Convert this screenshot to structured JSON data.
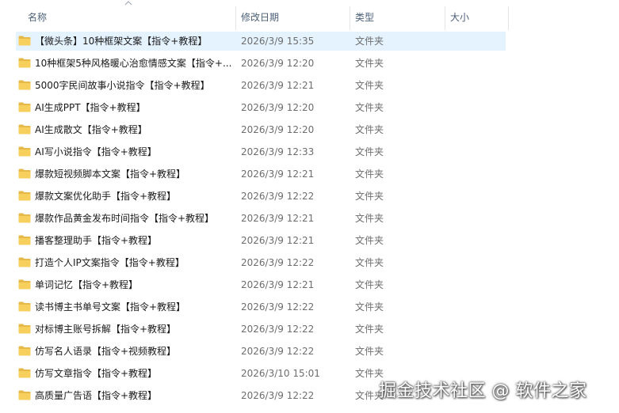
{
  "columns": {
    "name": "名称",
    "date": "修改日期",
    "type": "类型",
    "size": "大小"
  },
  "icons": {
    "folder": "folder-icon",
    "sort": "sort-ascending-icon"
  },
  "colors": {
    "folder": "#f7cf5c",
    "selection": "#e5f3ff",
    "header_text": "#4c607a"
  },
  "selected_index": 0,
  "rows": [
    {
      "name": "【微头条】10种框架文案【指令+教程】",
      "date": "2026/3/9 15:35",
      "type": "文件夹"
    },
    {
      "name": "10种框架5种风格暖心治愈情感文案【指令+...",
      "date": "2026/3/9 12:20",
      "type": "文件夹"
    },
    {
      "name": "5000字民间故事小说指令【指令+教程】",
      "date": "2026/3/9 12:21",
      "type": "文件夹"
    },
    {
      "name": "AI生成PPT【指令+教程】",
      "date": "2026/3/9 12:20",
      "type": "文件夹"
    },
    {
      "name": "AI生成散文【指令+教程】",
      "date": "2026/3/9 12:20",
      "type": "文件夹"
    },
    {
      "name": "AI写小说指令【指令+教程】",
      "date": "2026/3/9 12:33",
      "type": "文件夹"
    },
    {
      "name": "爆款短视频脚本文案【指令+教程】",
      "date": "2026/3/9 12:21",
      "type": "文件夹"
    },
    {
      "name": "爆款文案优化助手【指令+教程】",
      "date": "2026/3/9 12:22",
      "type": "文件夹"
    },
    {
      "name": "爆款作品黄金发布时间指令【指令+教程】",
      "date": "2026/3/9 12:21",
      "type": "文件夹"
    },
    {
      "name": "播客整理助手【指令+教程】",
      "date": "2026/3/9 12:21",
      "type": "文件夹"
    },
    {
      "name": "打造个人IP文案指令【指令+教程】",
      "date": "2026/3/9 12:22",
      "type": "文件夹"
    },
    {
      "name": "单词记忆【指令+教程】",
      "date": "2026/3/9 12:21",
      "type": "文件夹"
    },
    {
      "name": "读书博主书单号文案【指令+教程】",
      "date": "2026/3/9 12:22",
      "type": "文件夹"
    },
    {
      "name": "对标博主账号拆解【指令+教程】",
      "date": "2026/3/9 12:22",
      "type": "文件夹"
    },
    {
      "name": "仿写名人语录【指令+视频教程】",
      "date": "2026/3/9 12:22",
      "type": "文件夹"
    },
    {
      "name": "仿写文章指令【指令+教程】",
      "date": "2026/3/10 15:01",
      "type": "文件夹"
    },
    {
      "name": "高质量广告语【指令+教程】",
      "date": "2026/3/9 12:22",
      "type": "文件夹"
    }
  ],
  "watermark": "掘金技术社区 @ 软件之家"
}
